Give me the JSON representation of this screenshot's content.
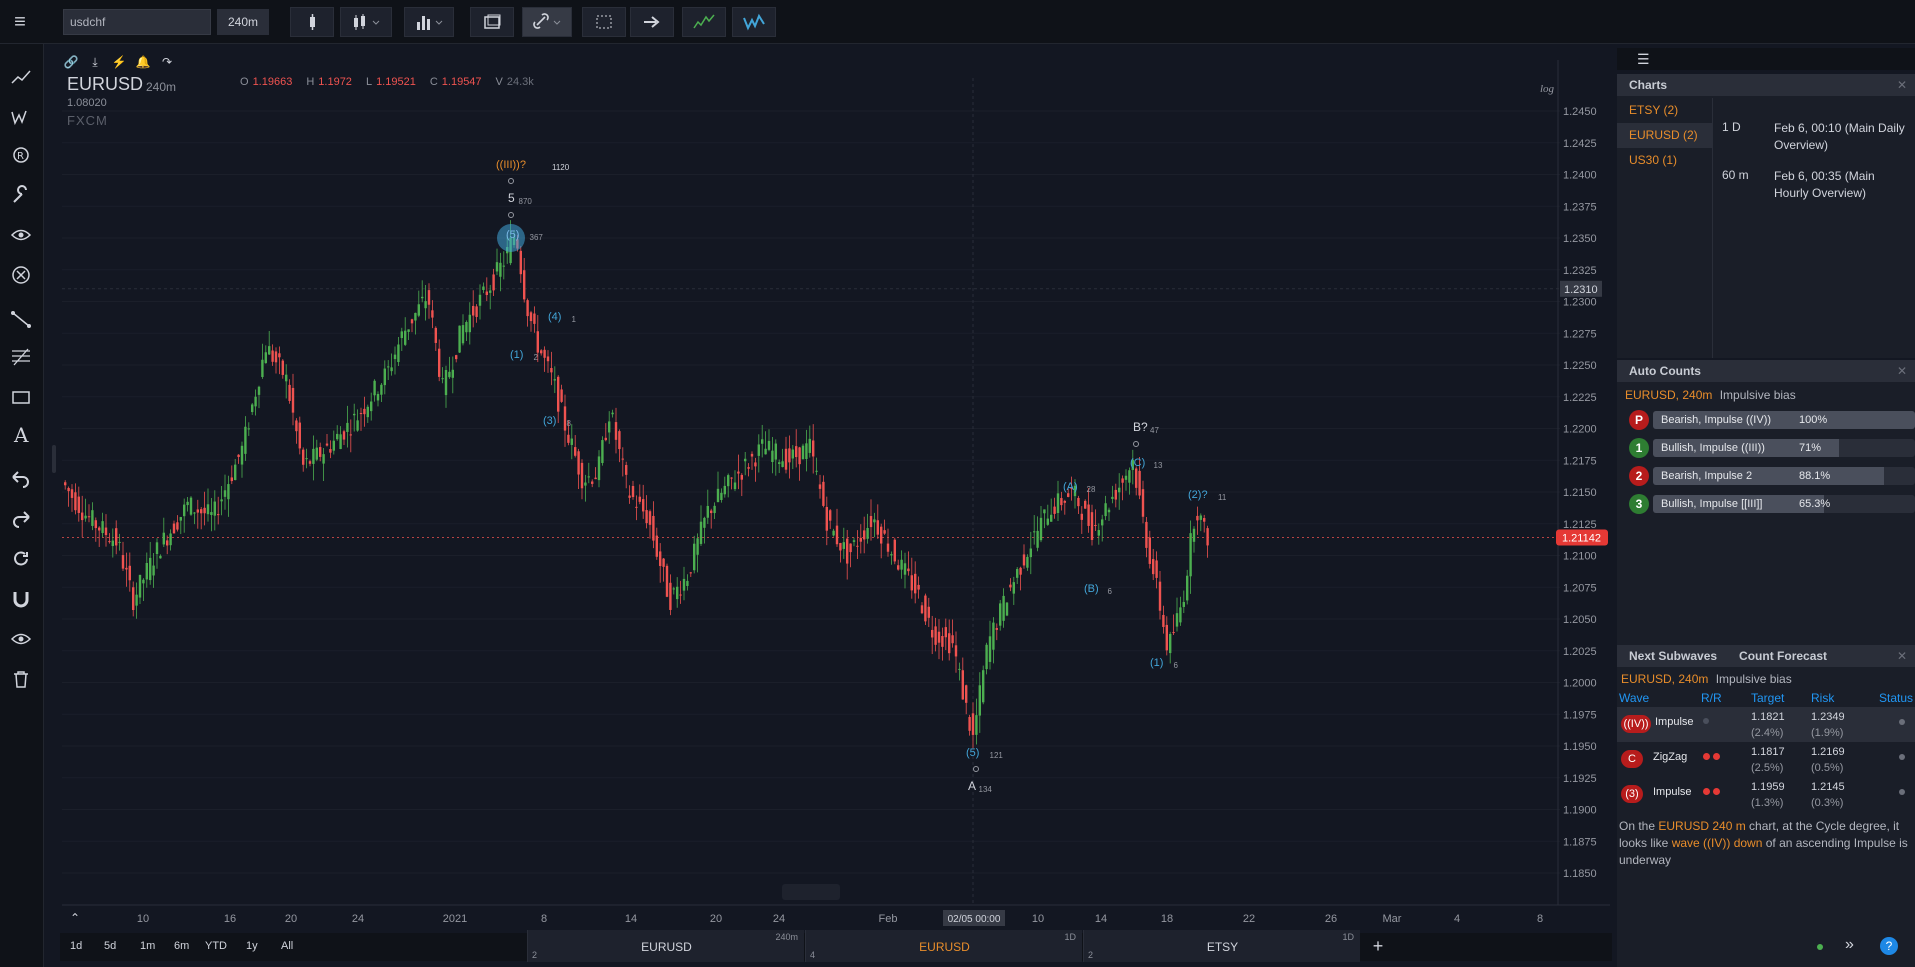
{
  "toolbar": {
    "symbol_value": "usdchf",
    "interval_label": "240m"
  },
  "legend": {
    "symbol": "EURUSD",
    "interval": "240m",
    "price": "1.08020",
    "broker": "FXCM",
    "ohlc": [
      {
        "k": "O",
        "v": "1.19663"
      },
      {
        "k": "H",
        "v": "1.1972"
      },
      {
        "k": "L",
        "v": "1.19521"
      },
      {
        "k": "C",
        "v": "1.19547"
      },
      {
        "k": "V",
        "v": "24.3k"
      }
    ]
  },
  "price_axis": {
    "ticks": [
      "1.2450",
      "1.2425",
      "1.2400",
      "1.2375",
      "1.2350",
      "1.2325",
      "1.2300",
      "1.2275",
      "1.2250",
      "1.2225",
      "1.2200",
      "1.2175",
      "1.2150",
      "1.2125",
      "1.2100",
      "1.2075",
      "1.2050",
      "1.2025",
      "1.2000",
      "1.1975",
      "1.1950",
      "1.1925",
      "1.1900",
      "1.1875",
      "1.1850"
    ],
    "crosshair_price": "1.2310",
    "last_price": "1.21142",
    "log_label": "log"
  },
  "time_axis": {
    "ticks": [
      "10",
      "16",
      "20",
      "24",
      "2021",
      "8",
      "14",
      "20",
      "24",
      "Feb",
      "10",
      "14",
      "18",
      "22",
      "26",
      "Mar",
      "4",
      "8"
    ],
    "crosshair_time": "02/05 00:00"
  },
  "wave_labels": [
    {
      "t": "((III))?",
      "sub": "1120",
      "color": "#e88d2b"
    },
    {
      "t": "5",
      "sub": "870",
      "color": "#d1d4dc"
    },
    {
      "t": "(5)",
      "sub": "367",
      "color": "#7ab8e8"
    },
    {
      "t": "(4)",
      "sub": "1",
      "color": "#42a5d8"
    },
    {
      "t": "(1)",
      "sub": "2",
      "color": "#42a5d8"
    },
    {
      "t": "(3)",
      "sub": "8",
      "color": "#42a5d8"
    },
    {
      "t": "(5)",
      "sub": "121",
      "color": "#42a5d8"
    },
    {
      "t": "A",
      "sub": "134",
      "color": "#d1d4dc"
    },
    {
      "t": "(A)",
      "sub": "28",
      "color": "#42a5d8"
    },
    {
      "t": "(B)",
      "sub": "6",
      "color": "#42a5d8"
    },
    {
      "t": "B?",
      "sub": "47",
      "color": "#d1d4dc"
    },
    {
      "t": "(C)",
      "sub": "13",
      "color": "#42a5d8"
    },
    {
      "t": "(1)",
      "sub": "6",
      "color": "#42a5d8"
    },
    {
      "t": "(2)?",
      "sub": "11",
      "color": "#42a5d8"
    }
  ],
  "charts_panel": {
    "title": "Charts",
    "list": [
      {
        "label": "ETSY (2)"
      },
      {
        "label": "EURUSD (2)"
      },
      {
        "label": "US30 (1)"
      }
    ],
    "details": [
      {
        "interval": "1 D",
        "desc": "Feb 6, 00:10 (Main Daily Overview)"
      },
      {
        "interval": "60 m",
        "desc": "Feb 6, 00:35 (Main Hourly Overview)"
      }
    ]
  },
  "auto_counts": {
    "title": "Auto Counts",
    "subtitle_sym": "EURUSD, 240m",
    "subtitle_bias": "Impulsive bias",
    "rows": [
      {
        "badge": "P",
        "label": "Bearish, Impulse ((IV))",
        "pct": "100%",
        "frac": 1.0,
        "color": "#b71c1c"
      },
      {
        "badge": "1",
        "label": "Bullish, Impulse ((III))",
        "pct": "71%",
        "frac": 0.71,
        "color": "#2e7d32"
      },
      {
        "badge": "2",
        "label": "Bearish, Impulse 2",
        "pct": "88.1%",
        "frac": 0.881,
        "color": "#b71c1c"
      },
      {
        "badge": "3",
        "label": "Bullish, Impulse [[III]]",
        "pct": "65.3%",
        "frac": 0.653,
        "color": "#2e7d32"
      }
    ]
  },
  "next_subwaves": {
    "tab1": "Next Subwaves",
    "tab2": "Count Forecast",
    "subtitle_sym": "EURUSD, 240m",
    "subtitle_bias": "Impulsive bias",
    "headers": {
      "wave": "Wave",
      "rr": "R/R",
      "target": "Target",
      "risk": "Risk",
      "status": "Status"
    },
    "rows": [
      {
        "badge": "((IV))",
        "name": "Impulse",
        "target": "1.1821",
        "target_pct": "(2.4%)",
        "risk": "1.2349",
        "risk_pct": "(1.9%)"
      },
      {
        "badge": "C",
        "name": "ZigZag",
        "target": "1.1817",
        "target_pct": "(2.5%)",
        "risk": "1.2169",
        "risk_pct": "(0.5%)"
      },
      {
        "badge": "(3)",
        "name": "Impulse",
        "target": "1.1959",
        "target_pct": "(1.3%)",
        "risk": "1.2145",
        "risk_pct": "(0.3%)"
      }
    ],
    "commentary_1": "On the ",
    "commentary_2": "EURUSD 240 m",
    "commentary_3": " chart, at the Cycle degree, it looks like ",
    "commentary_4": "wave ((IV)) down",
    "commentary_5": " of an ascending Impulse is underway"
  },
  "range_buttons": [
    "1d",
    "5d",
    "1m",
    "6m",
    "YTD",
    "1y",
    "All"
  ],
  "bottom_tabs": [
    {
      "name": "EURUSD",
      "interval": "240m",
      "num": "2",
      "active": false
    },
    {
      "name": "EURUSD",
      "interval": "1D",
      "num": "4",
      "active": true
    },
    {
      "name": "ETSY",
      "interval": "1D",
      "num": "2",
      "active": false
    }
  ],
  "colors": {
    "up": "#4caf50",
    "down": "#ef5350",
    "accent": "#e88d2b",
    "wave_blue": "#42a5d8"
  }
}
